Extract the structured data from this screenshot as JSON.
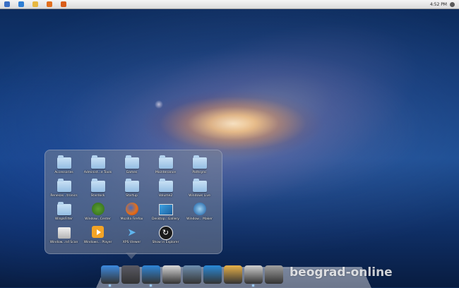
{
  "menubar": {
    "clock": "4:52 PM",
    "left_icons": [
      {
        "icon": "orb-icon",
        "color": "#3a6fc4"
      },
      {
        "icon": "ie-icon",
        "color": "#2f7fd4"
      },
      {
        "icon": "folder-icon",
        "color": "#e7b740"
      },
      {
        "icon": "media-icon",
        "color": "#e26f1e"
      },
      {
        "icon": "firefox-icon",
        "color": "#d95d1a"
      }
    ]
  },
  "stack": {
    "items": [
      {
        "label": "Accessories",
        "icon": "folder-icon"
      },
      {
        "label": "Administ...e Tools",
        "icon": "folder-icon"
      },
      {
        "label": "Games",
        "icon": "folder-icon"
      },
      {
        "label": "Maintenance",
        "icon": "folder-icon"
      },
      {
        "label": "Pathsync",
        "icon": "folder-icon"
      },
      {
        "label": "Renesas...tronics",
        "icon": "folder-icon"
      },
      {
        "label": "Stardock",
        "icon": "folder-icon"
      },
      {
        "label": "Startup",
        "icon": "folder-icon"
      },
      {
        "label": "Volume2",
        "icon": "folder-icon"
      },
      {
        "label": "Windows Live",
        "icon": "folder-icon"
      },
      {
        "label": "WinpkFilter",
        "icon": "folder-icon"
      },
      {
        "label": "Window...Center",
        "icon": "windows-icon"
      },
      {
        "label": "Mozilla Firefox",
        "icon": "firefox-icon"
      },
      {
        "label": "Desktop...Gallery",
        "icon": "desktop-icon"
      },
      {
        "label": "Window... Maker",
        "icon": "moviemaker-icon"
      },
      {
        "label": "Window...nd Scan",
        "icon": "fax-icon"
      },
      {
        "label": "Windows... Player",
        "icon": "mediaplayer-icon"
      },
      {
        "label": "XPS Viewer",
        "icon": "xps-icon"
      },
      {
        "label": "Show in Explorer",
        "icon": "explorer-icon"
      }
    ]
  },
  "dock": {
    "items": [
      {
        "icon": "finder-icon",
        "color": "#3d8ae0",
        "running": true
      },
      {
        "icon": "rocket-icon",
        "color": "#5a5a64",
        "running": false
      },
      {
        "icon": "safari-icon",
        "color": "#2f86d8",
        "running": true
      },
      {
        "icon": "mail-icon",
        "color": "#d8d8d8",
        "running": false
      },
      {
        "icon": "photos-icon",
        "color": "#6e8fb0",
        "running": false
      },
      {
        "icon": "itunes-icon",
        "color": "#2a8ad8",
        "running": false
      },
      {
        "icon": "home-icon",
        "color": "#e8b24a",
        "running": false
      },
      {
        "icon": "window-icon",
        "color": "#cfcfcf",
        "running": true
      },
      {
        "icon": "grid-icon",
        "color": "#a0a0a0",
        "running": false
      }
    ]
  },
  "watermark": "beograd-online"
}
